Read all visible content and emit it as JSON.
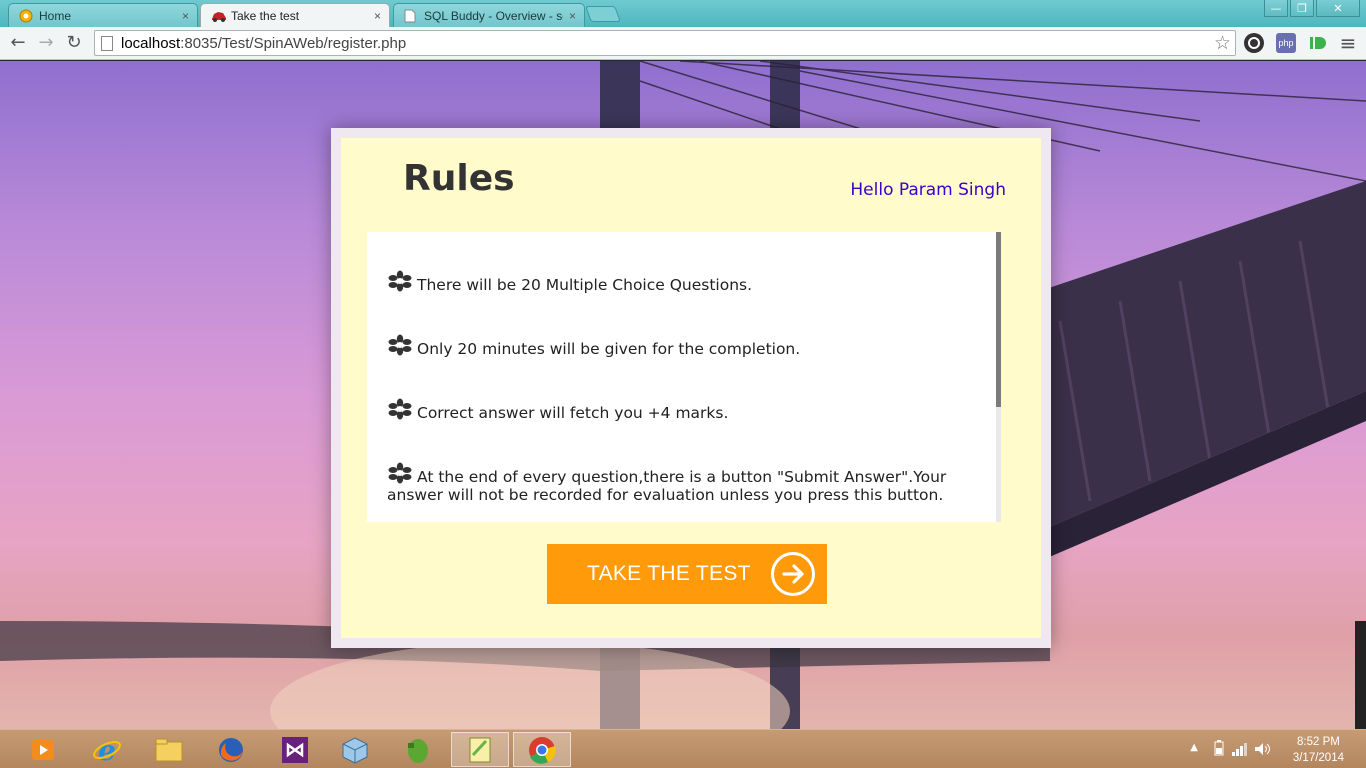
{
  "browser": {
    "tabs": [
      {
        "title": "Home",
        "icon": "home-tab-favicon",
        "active": false
      },
      {
        "title": "Take the test",
        "icon": "red-car-favicon",
        "active": true
      },
      {
        "title": "SQL Buddy - Overview - sq",
        "icon": "page-favicon",
        "active": false
      }
    ],
    "close_glyph": "×",
    "address": {
      "host": "localhost",
      "rest": ":8035/Test/SpinAWeb/register.php"
    },
    "extensions": [
      {
        "name": "circle-extension-icon",
        "label": ""
      },
      {
        "name": "php-extension-icon",
        "label": "php"
      },
      {
        "name": "green-d-extension-icon",
        "label": ""
      }
    ],
    "window_controls": {
      "minimize": "—",
      "maximize": "❐",
      "close": "✕"
    }
  },
  "rules_page": {
    "title": "Rules",
    "greeting": "Hello Param Singh",
    "rules": [
      "There will be 20 Multiple Choice Questions.",
      "Only 20 minutes will be given for the completion.",
      "Correct answer will fetch you +4 marks.",
      "At the end of every question,there is a button \"Submit Answer\".Your answer will not be recorded for evaluation unless you press this button."
    ],
    "scroll_position": 0,
    "cta_label": "TAKE THE TEST",
    "colors": {
      "card": "#fffbcb",
      "greeting": "#3b00c9",
      "cta": "#ff9a0b"
    }
  },
  "taskbar": {
    "apps": [
      "media-player-icon",
      "internet-explorer-icon",
      "file-explorer-icon",
      "firefox-icon",
      "visual-studio-icon",
      "virtualbox-icon",
      "evernote-icon",
      "notepad-plus-plus-icon",
      "chrome-icon"
    ],
    "time": "8:52 PM",
    "date": "3/17/2014"
  }
}
